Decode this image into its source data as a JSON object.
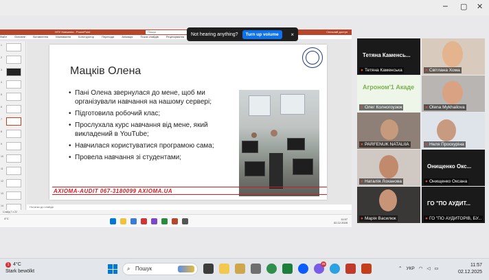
{
  "zoom": {
    "toast": {
      "message": "Not hearing anything?",
      "button": "Turn up volume",
      "close": "×"
    }
  },
  "powerpoint": {
    "title": "НПУ Навчання - PowerPoint",
    "search_placeholder": "Пошук",
    "share": "Спільний доступ",
    "ribbon_tabs": [
      "Файл",
      "Основне",
      "Вставлення",
      "Малювання",
      "Конструктор",
      "Переходи",
      "Анімація",
      "Показ слайдів",
      "Рецензування",
      "Подання",
      "Запис"
    ],
    "slide_numbers": [
      "1",
      "2",
      "3",
      "4",
      "5",
      "6",
      "7",
      "8",
      "9",
      "10",
      "11",
      "12",
      "13",
      "14"
    ],
    "notes_placeholder": "Нотатки до слайда",
    "status": "Слайд 7 з 22",
    "slide": {
      "title": "Мацків Олена",
      "bullets": [
        "Пані Олена звернулася до мене, щоб ми організували навчання на нашому сервері;",
        "Підготовила робочий клас;",
        "Прослухала курс навчання від мене, який викладений в YouTube;",
        "Навчилася користуватися програмою сама;",
        "Провела навчання зі студентами;"
      ],
      "footer": "AXIOMA-AUDIT 067-3180099 AXIOMA.UA"
    },
    "remote_taskbar": {
      "temp": "4°C",
      "time": "11:57",
      "date": "02.12.2025"
    }
  },
  "gallery": [
    {
      "name": "Тетяна Каменська",
      "big": "Тетяна Каменсь...",
      "video": false
    },
    {
      "name": "Світлана Хома",
      "video": true
    },
    {
      "name": "Олег Колногоузюк",
      "big": "Агроном'1  Акаде",
      "video": true
    },
    {
      "name": "Olena Mykhailova",
      "video": true
    },
    {
      "name": "PARFENUK NATALIIA",
      "video": true
    },
    {
      "name": "Неля Проскуріна",
      "video": true
    },
    {
      "name": "Наталія Лоханова",
      "video": true
    },
    {
      "name": "Онищенко Оксана",
      "big": "Онищенко Окс...",
      "video": false
    },
    {
      "name": "Марія Василюк",
      "video": true
    },
    {
      "name": "ГО \"ПО АУДИТОРІВ, БУ...",
      "big": "ГО \"ПО АУДИТ...",
      "video": false
    }
  ],
  "taskbar": {
    "weather_temp": "4°C",
    "weather_desc": "Stark bewölkt",
    "weather_badge": "1",
    "search": "Пошук",
    "lang": "УКР",
    "time": "11:57",
    "date": "02.12.2025",
    "notification_count": "26"
  }
}
